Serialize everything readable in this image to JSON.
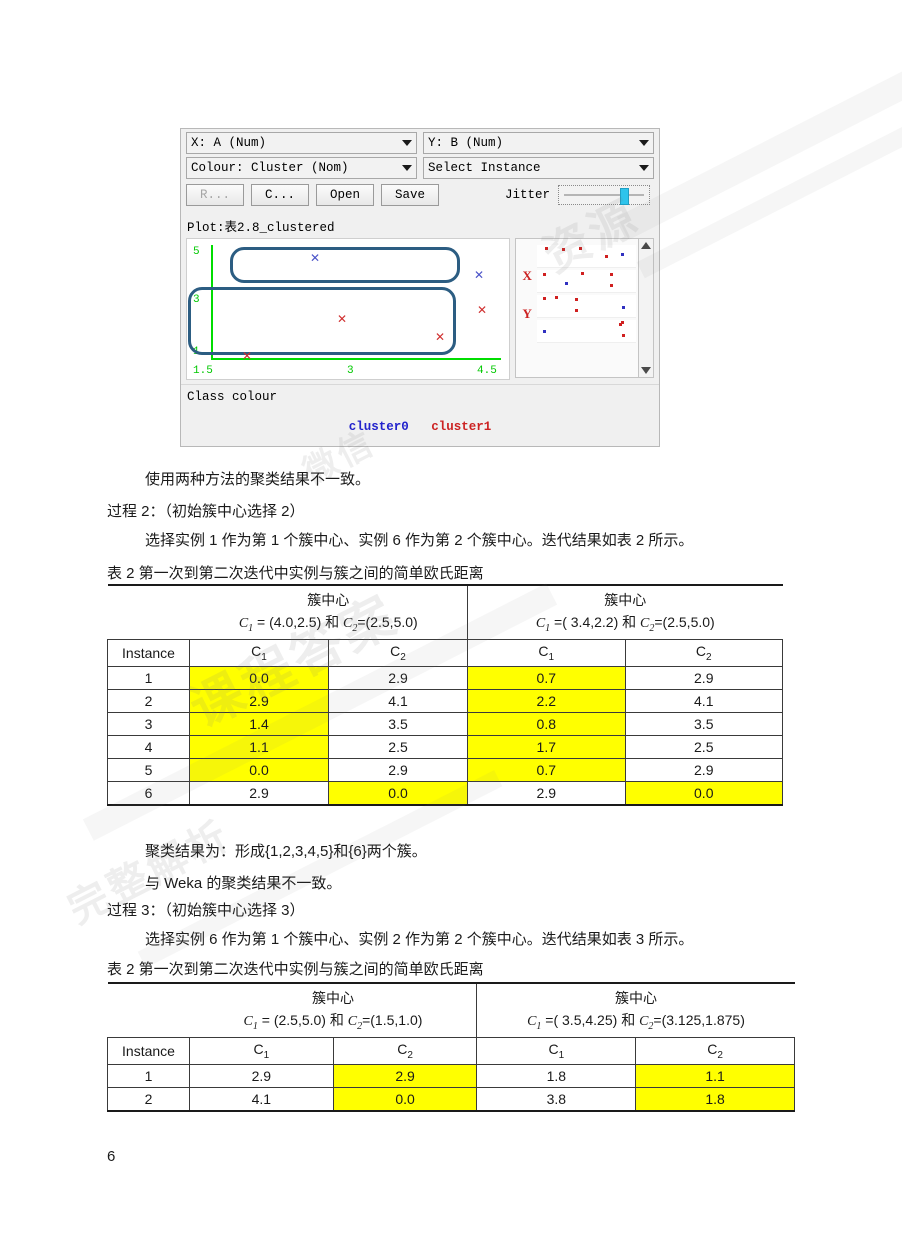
{
  "weka": {
    "x_combo": "X: A (Num)",
    "y_combo": "Y: B (Num)",
    "colour_combo": "Colour: Cluster (Nom)",
    "instance_combo": "Select Instance",
    "buttons": {
      "reset": "R...",
      "clear": "C...",
      "open": "Open",
      "save": "Save"
    },
    "jitter_label": "Jitter",
    "jitter_value_pct": 68,
    "plot_title": "Plot:表2.8_clustered",
    "class_colour_label": "Class colour",
    "legend": {
      "cluster0": "cluster0",
      "cluster1": "cluster1",
      "cluster0_color": "#2222cc",
      "cluster1_color": "#cc2222"
    },
    "attr_panel": {
      "letters": [
        "X",
        "Y"
      ]
    },
    "axis": {
      "y_ticks": [
        "5",
        "3",
        "1"
      ],
      "x_ticks": [
        "1.5",
        "3",
        "4.5"
      ],
      "axis_color": "#00dd00"
    },
    "annotation_boxes": 2
  },
  "chart_data": {
    "type": "scatter",
    "title": "Plot:表2.8_clustered",
    "xlabel": "A",
    "ylabel": "B",
    "xlim": [
      1.5,
      4.5
    ],
    "ylim": [
      1,
      5
    ],
    "xticks": [
      1.5,
      3,
      4.5
    ],
    "yticks": [
      1,
      3,
      5
    ],
    "grid": false,
    "legend_position": "bottom-center",
    "series": [
      {
        "name": "cluster0",
        "color": "#4b53c8",
        "marker": "x",
        "points": [
          [
            2.4,
            5.0
          ],
          [
            4.3,
            4.6
          ]
        ]
      },
      {
        "name": "cluster1",
        "color": "#d03030",
        "marker": "x",
        "points": [
          [
            1.8,
            1.0
          ],
          [
            2.9,
            2.6
          ],
          [
            3.9,
            2.15
          ],
          [
            4.3,
            3.0
          ]
        ]
      }
    ],
    "annotations": [
      {
        "shape": "rounded-rect",
        "label": "cluster0-group",
        "color": "#2c5d82"
      },
      {
        "shape": "rounded-rect",
        "label": "cluster1-group",
        "color": "#2c5d82"
      }
    ]
  },
  "body": {
    "line_conclusion_1": "使用两种方法的聚类结果不一致。",
    "process2_heading": "过程 2：（初始簇中心选择 2）",
    "process2_desc": "选择实例 1 作为第 1 个簇中心、实例 6 作为第 2 个簇中心。迭代结果如表 2 所示。",
    "table1_caption": "表 2 第一次到第二次迭代中实例与簇之间的简单欧氏距离",
    "result_line_1": "聚类结果为：形成{1,2,3,4,5}和{6}两个簇。",
    "result_line_2": "与 Weka 的聚类结果不一致。",
    "process3_heading": "过程 3：（初始簇中心选择 3）",
    "process3_desc": "选择实例 6 作为第 1 个簇中心、实例 2 作为第 2 个簇中心。迭代结果如表 3 所示。",
    "table2_caption": "表 2 第一次到第二次迭代中实例与簇之间的简单欧氏距离",
    "page_number": "6"
  },
  "table1": {
    "group_headers": [
      "簇中心",
      "簇中心"
    ],
    "group_formulas": [
      {
        "c1": "= (4.0,2.5)",
        "c2": "=(2.5,5.0)",
        "conj": "和"
      },
      {
        "c1": "=( 3.4,2.2)",
        "c2": "=(2.5,5.0)",
        "conj": "和"
      }
    ],
    "columns": [
      "Instance",
      "C1",
      "C2",
      "C1",
      "C2"
    ],
    "rows": [
      {
        "instance": "1",
        "cells": [
          {
            "v": "0.0",
            "hl": true
          },
          {
            "v": "2.9",
            "hl": false
          },
          {
            "v": "0.7",
            "hl": true
          },
          {
            "v": "2.9",
            "hl": false
          }
        ]
      },
      {
        "instance": "2",
        "cells": [
          {
            "v": "2.9",
            "hl": true
          },
          {
            "v": "4.1",
            "hl": false
          },
          {
            "v": "2.2",
            "hl": true
          },
          {
            "v": "4.1",
            "hl": false
          }
        ]
      },
      {
        "instance": "3",
        "cells": [
          {
            "v": "1.4",
            "hl": true
          },
          {
            "v": "3.5",
            "hl": false
          },
          {
            "v": "0.8",
            "hl": true
          },
          {
            "v": "3.5",
            "hl": false
          }
        ]
      },
      {
        "instance": "4",
        "cells": [
          {
            "v": "1.1",
            "hl": true
          },
          {
            "v": "2.5",
            "hl": false
          },
          {
            "v": "1.7",
            "hl": true
          },
          {
            "v": "2.5",
            "hl": false
          }
        ]
      },
      {
        "instance": "5",
        "cells": [
          {
            "v": "0.0",
            "hl": true
          },
          {
            "v": "2.9",
            "hl": false
          },
          {
            "v": "0.7",
            "hl": true
          },
          {
            "v": "2.9",
            "hl": false
          }
        ]
      },
      {
        "instance": "6",
        "cells": [
          {
            "v": "2.9",
            "hl": false
          },
          {
            "v": "0.0",
            "hl": true
          },
          {
            "v": "2.9",
            "hl": false
          },
          {
            "v": "0.0",
            "hl": true
          }
        ]
      }
    ]
  },
  "table2": {
    "group_headers": [
      "簇中心",
      "簇中心"
    ],
    "group_formulas": [
      {
        "c1": "= (2.5,5.0)",
        "c2": "=(1.5,1.0)",
        "conj": "和"
      },
      {
        "c1": "=( 3.5,4.25)",
        "c2": "=(3.125,1.875)",
        "conj": "和"
      }
    ],
    "columns": [
      "Instance",
      "C1",
      "C2",
      "C1",
      "C2"
    ],
    "rows": [
      {
        "instance": "1",
        "cells": [
          {
            "v": "2.9",
            "hl": false
          },
          {
            "v": "2.9",
            "hl": true
          },
          {
            "v": "1.8",
            "hl": false
          },
          {
            "v": "1.1",
            "hl": true
          }
        ]
      },
      {
        "instance": "2",
        "cells": [
          {
            "v": "4.1",
            "hl": false
          },
          {
            "v": "0.0",
            "hl": true
          },
          {
            "v": "3.8",
            "hl": false
          },
          {
            "v": "1.8",
            "hl": true
          }
        ]
      }
    ]
  }
}
